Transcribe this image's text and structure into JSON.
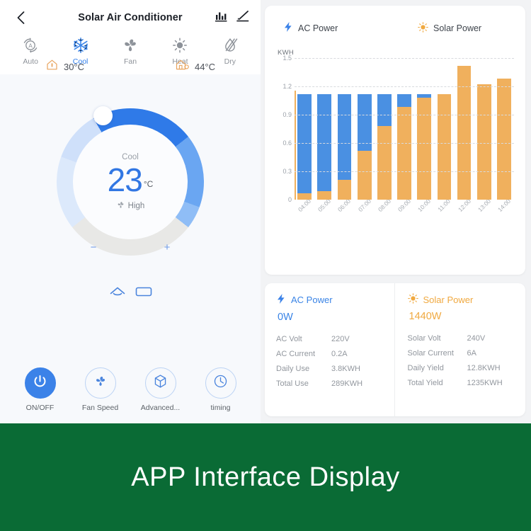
{
  "header": {
    "title": "Solar Air Conditioner",
    "back_icon": "chevron-left-icon",
    "stats_icon": "bar-chart-icon",
    "edit_icon": "pencil-icon"
  },
  "modes": [
    {
      "label": "Auto",
      "icon": "auto-mode-icon",
      "active": false
    },
    {
      "label": "Cool",
      "icon": "snowflake-icon",
      "active": true
    },
    {
      "label": "Fan",
      "icon": "fan-icon",
      "active": false
    },
    {
      "label": "Heat",
      "icon": "sun-icon",
      "active": false
    },
    {
      "label": "Dry",
      "icon": "droplet-slash-icon",
      "active": false
    }
  ],
  "temps": {
    "indoor": {
      "icon": "house-thermometer-icon",
      "value": "30°C"
    },
    "outdoor": {
      "icon": "house-outdoor-icon",
      "value": "44°C"
    }
  },
  "dial": {
    "mode_label": "Cool",
    "temperature": "23",
    "unit": "°C",
    "fan_label": "High",
    "fan_icon": "fan-icon",
    "minus_label": "−",
    "plus_label": "+",
    "accent": "#3277e3"
  },
  "connectivity": [
    {
      "icon": "cloud-icon"
    },
    {
      "icon": "remote-screen-icon"
    }
  ],
  "bottom_buttons": [
    {
      "label": "ON/OFF",
      "icon": "power-icon",
      "active": true
    },
    {
      "label": "Fan Speed",
      "icon": "fan-icon",
      "active": false
    },
    {
      "label": "Advanced...",
      "icon": "cube-icon",
      "active": false
    },
    {
      "label": "timing",
      "icon": "clock-icon",
      "active": false
    }
  ],
  "chart_legend": [
    {
      "label": "AC Power",
      "icon": "lightning-icon",
      "color": "#4a90e2"
    },
    {
      "label": "Solar Power",
      "icon": "sun-icon",
      "color": "#f0b05d"
    }
  ],
  "chart_data": {
    "type": "bar",
    "title": "",
    "subtitle": "",
    "stacked": true,
    "xlabel": "",
    "ylabel": "KWH",
    "ylim": [
      0,
      1.5
    ],
    "yticks": [
      0,
      0.3,
      0.6,
      0.9,
      1.2,
      1.5
    ],
    "ytick_labels": [
      "0",
      "0.3",
      "0.6",
      "0.9",
      "1.2",
      "1.5"
    ],
    "grid": true,
    "legend_position": "top",
    "categories": [
      "04:00",
      "05:00",
      "06:00",
      "07:00",
      "08:00",
      "09:00",
      "10:00",
      "11:00",
      "12:00",
      "13:00",
      "14:00"
    ],
    "series": [
      {
        "name": "Solar Power",
        "color": "#f0b05d",
        "values": [
          0.07,
          0.09,
          0.21,
          0.52,
          0.78,
          0.98,
          1.08,
          1.12,
          1.42,
          1.22,
          1.28
        ]
      },
      {
        "name": "AC Power",
        "color": "#4a90e2",
        "values": [
          1.05,
          1.03,
          0.91,
          0.6,
          0.34,
          0.14,
          0.04,
          0.0,
          0.0,
          0.0,
          0.0
        ]
      }
    ]
  },
  "power_panels": {
    "ac": {
      "title": "AC Power",
      "icon": "lightning-icon",
      "color": "#3a84e6",
      "value": "0W",
      "rows": [
        {
          "key": "AC  Volt",
          "value": "220V"
        },
        {
          "key": "AC Current",
          "value": "0.2A"
        },
        {
          "key": "Daily Use",
          "value": "3.8KWH"
        },
        {
          "key": "Total Use",
          "value": "289KWH"
        }
      ]
    },
    "solar": {
      "title": "Solar Power",
      "icon": "sun-icon",
      "color": "#f0a940",
      "value": "1440W",
      "rows": [
        {
          "key": "Solar Volt",
          "value": "240V"
        },
        {
          "key": "Solar Current",
          "value": "6A"
        },
        {
          "key": "Daily Yield",
          "value": "12.8KWH"
        },
        {
          "key": "Total Yield",
          "value": "1235KWH"
        }
      ]
    }
  },
  "banner": {
    "text": "APP Interface Display",
    "background": "#0a6b35"
  }
}
